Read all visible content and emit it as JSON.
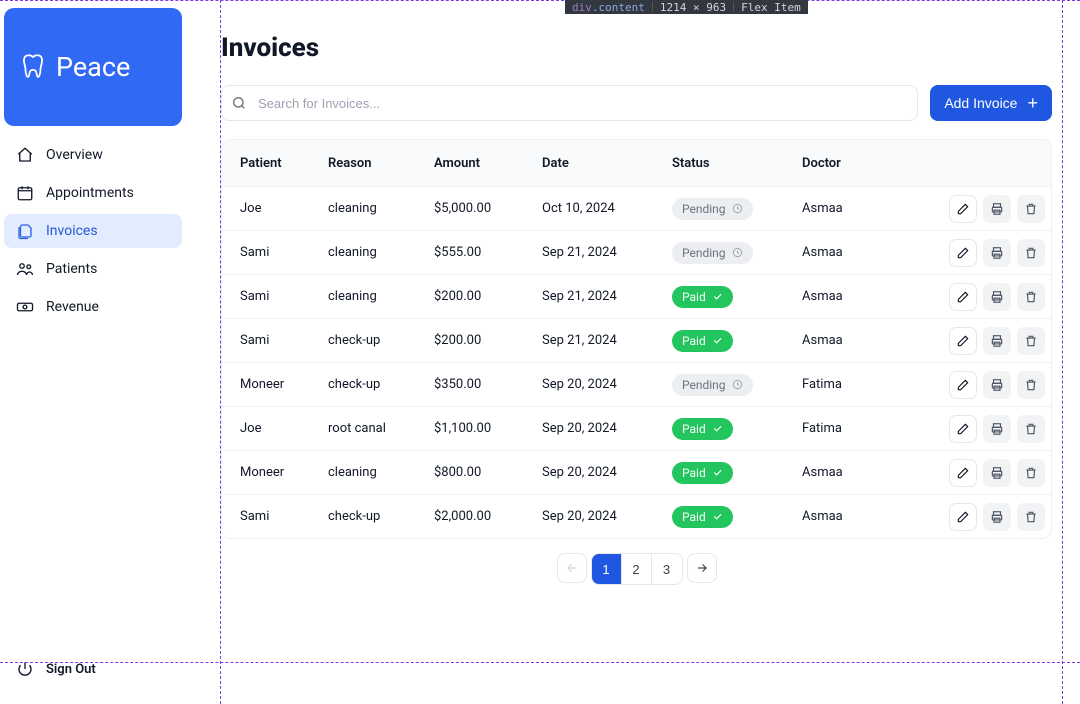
{
  "devtools": {
    "selector_prefix": "div",
    "selector_class": ".content",
    "dimensions": "1214 × 963",
    "layout": "Flex Item"
  },
  "brand": {
    "name": "Peace"
  },
  "nav": {
    "items": [
      {
        "label": "Overview",
        "icon": "home-icon"
      },
      {
        "label": "Appointments",
        "icon": "calendar-icon"
      },
      {
        "label": "Invoices",
        "icon": "file-icon"
      },
      {
        "label": "Patients",
        "icon": "users-icon"
      },
      {
        "label": "Revenue",
        "icon": "banknote-icon"
      }
    ],
    "active_index": 2
  },
  "signout_label": "Sign Out",
  "page": {
    "title": "Invoices"
  },
  "toolbar": {
    "search_placeholder": "Search for Invoices...",
    "add_label": "Add Invoice"
  },
  "table": {
    "columns": [
      "Patient",
      "Reason",
      "Amount",
      "Date",
      "Status",
      "Doctor"
    ],
    "rows": [
      {
        "patient": "Joe",
        "reason": "cleaning",
        "amount": "$5,000.00",
        "date": "Oct 10, 2024",
        "status": "Pending",
        "doctor": "Asmaa"
      },
      {
        "patient": "Sami",
        "reason": "cleaning",
        "amount": "$555.00",
        "date": "Sep 21, 2024",
        "status": "Pending",
        "doctor": "Asmaa"
      },
      {
        "patient": "Sami",
        "reason": "cleaning",
        "amount": "$200.00",
        "date": "Sep 21, 2024",
        "status": "Paid",
        "doctor": "Asmaa"
      },
      {
        "patient": "Sami",
        "reason": "check-up",
        "amount": "$200.00",
        "date": "Sep 21, 2024",
        "status": "Paid",
        "doctor": "Asmaa"
      },
      {
        "patient": "Moneer",
        "reason": "check-up",
        "amount": "$350.00",
        "date": "Sep 20, 2024",
        "status": "Pending",
        "doctor": "Fatima"
      },
      {
        "patient": "Joe",
        "reason": "root canal",
        "amount": "$1,100.00",
        "date": "Sep 20, 2024",
        "status": "Paid",
        "doctor": "Fatima"
      },
      {
        "patient": "Moneer",
        "reason": "cleaning",
        "amount": "$800.00",
        "date": "Sep 20, 2024",
        "status": "Paid",
        "doctor": "Asmaa"
      },
      {
        "patient": "Sami",
        "reason": "check-up",
        "amount": "$2,000.00",
        "date": "Sep 20, 2024",
        "status": "Paid",
        "doctor": "Asmaa"
      }
    ]
  },
  "pagination": {
    "pages": [
      "1",
      "2",
      "3"
    ],
    "current": "1"
  },
  "colors": {
    "primary": "#2057e0",
    "selection_outline": "#7c3aed"
  }
}
